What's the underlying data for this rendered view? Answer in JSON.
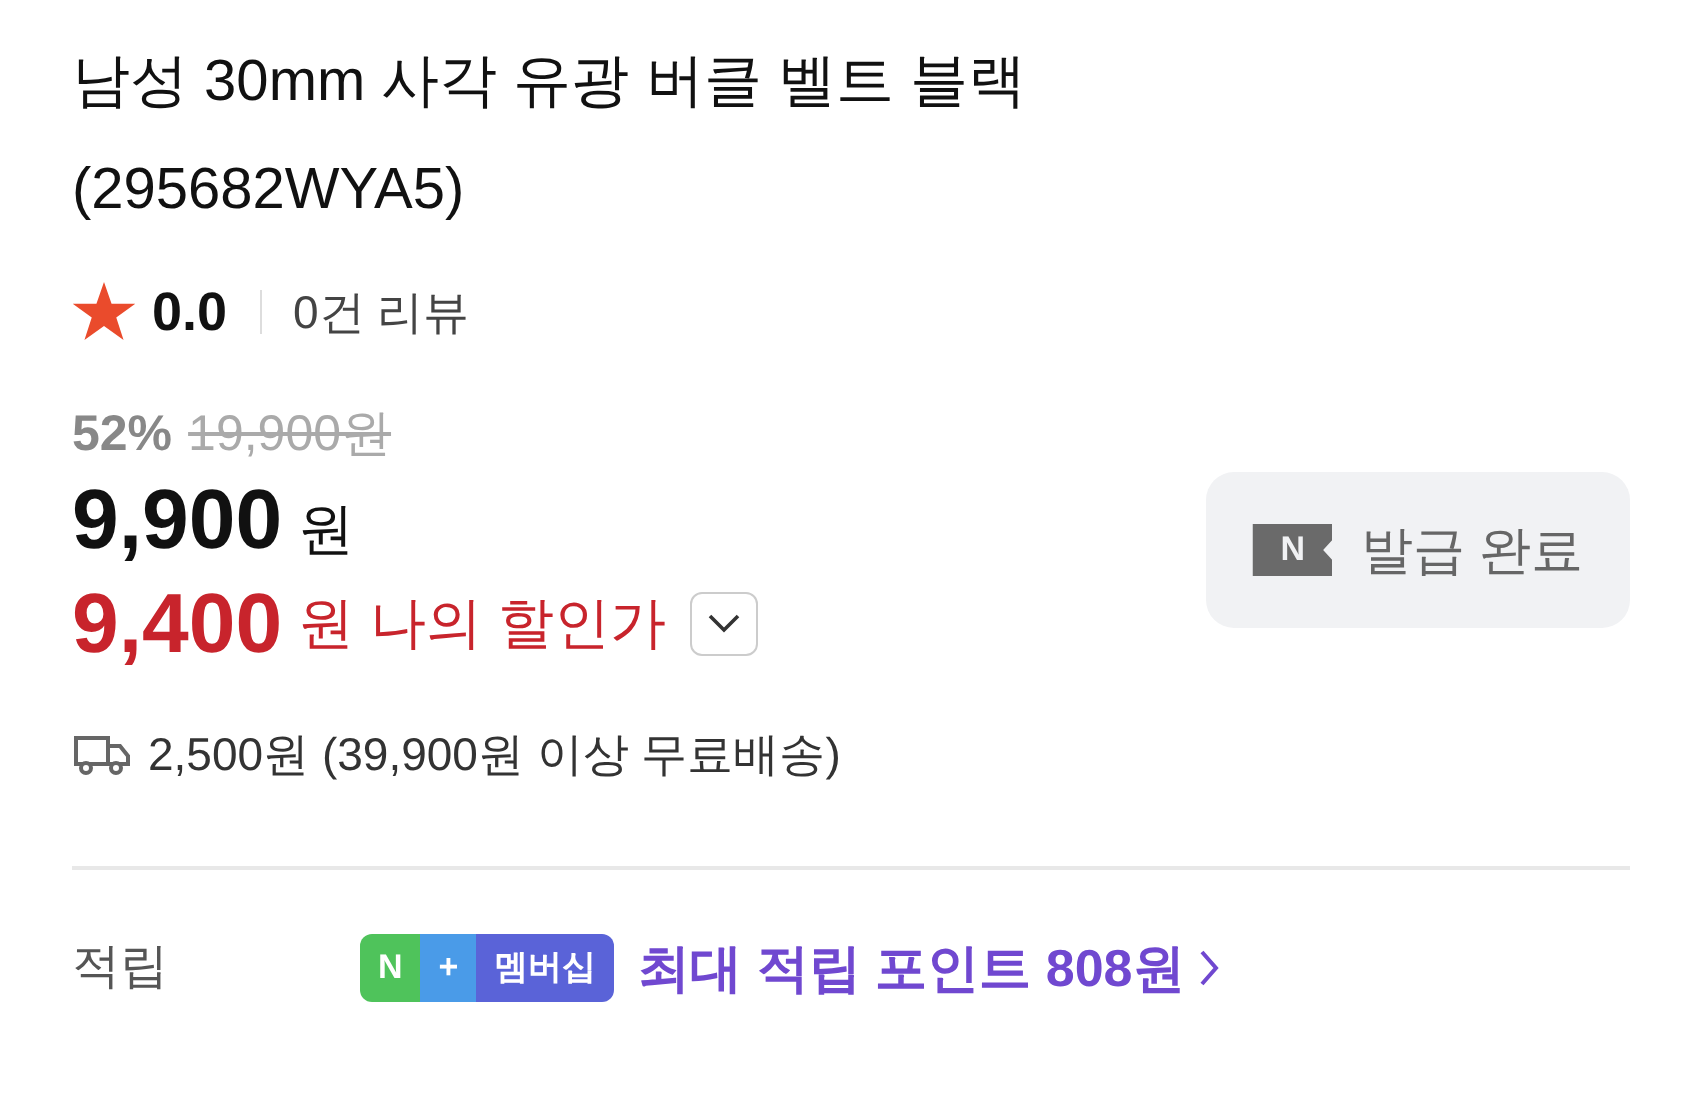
{
  "product": {
    "title": "남성 30mm 사각 유광 버클 벨트 블랙 (295682WYA5)"
  },
  "rating": {
    "score": "0.0",
    "reviews": "0건 리뷰"
  },
  "price": {
    "discount_rate": "52%",
    "original": "19,900원",
    "sale_amount": "9,900",
    "sale_unit": "원",
    "my_amount": "9,400",
    "my_unit": "원",
    "my_label": "나의 할인가",
    "expanded": false
  },
  "coupon_button": {
    "icon_text": "N",
    "label": "발급 완료",
    "disabled": true
  },
  "shipping": {
    "text": "2,500원 (39,900원 이상 무료배송)"
  },
  "points": {
    "label": "적립",
    "badge": [
      {
        "text": "N",
        "color": "#4fc35b"
      },
      {
        "text": "+",
        "color": "#4a9be8"
      },
      {
        "text": "멤버십",
        "color": "#5a63d8"
      }
    ],
    "text": "최대 적립 포인트 808원"
  }
}
